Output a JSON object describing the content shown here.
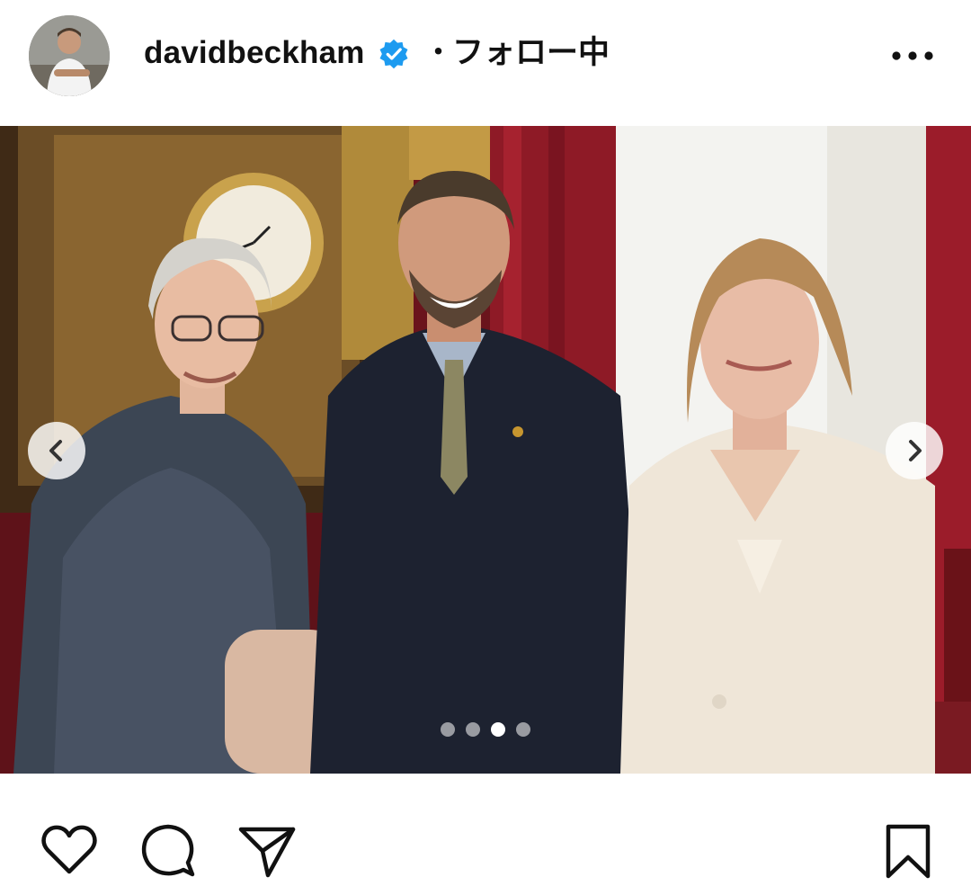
{
  "post_header": {
    "username": "davidbeckham",
    "separator": "・",
    "follow_status": "フォロー中",
    "verified": true,
    "avatar_icon": "profile-avatar",
    "more_icon": "more-options-icon"
  },
  "carousel": {
    "slide_count": 4,
    "active_slide_index": 2,
    "prev_icon": "chevron-left-icon",
    "next_icon": "chevron-right-icon"
  },
  "actions": {
    "like_icon": "heart-icon",
    "comment_icon": "comment-bubble-icon",
    "share_icon": "send-paper-plane-icon",
    "save_icon": "bookmark-icon"
  },
  "colors": {
    "verified_badge": "#1d9bf0",
    "background": "#ffffff",
    "text": "#111111"
  }
}
